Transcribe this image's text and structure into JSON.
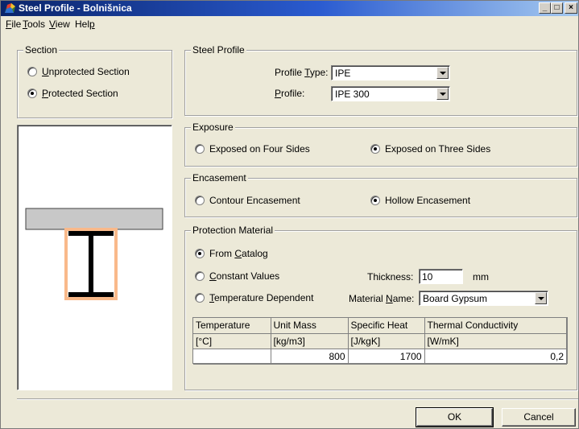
{
  "window": {
    "title": "Steel Profile - Bolnišnica",
    "controls": {
      "minimize": "_",
      "maximize": "□",
      "close": "×"
    }
  },
  "menu": [
    {
      "label": "File",
      "mnemonic": "F"
    },
    {
      "label": "Tools",
      "mnemonic": "T"
    },
    {
      "label": "View",
      "mnemonic": "V"
    },
    {
      "label": "Help",
      "mnemonic": "p"
    }
  ],
  "section": {
    "legend": "Section",
    "options": [
      {
        "label": "Unprotected Section",
        "checked": false
      },
      {
        "label": "Protected Section",
        "checked": true
      }
    ]
  },
  "steel_profile": {
    "legend": "Steel Profile",
    "profile_type_label": "Profile Type:",
    "profile_type_value": "IPE",
    "profile_label": "Profile:",
    "profile_value": "IPE 300"
  },
  "exposure": {
    "legend": "Exposure",
    "options": [
      {
        "label": "Exposed on Four Sides",
        "checked": false
      },
      {
        "label": "Exposed on Three Sides",
        "checked": true
      }
    ]
  },
  "encasement": {
    "legend": "Encasement",
    "options": [
      {
        "label": "Contour Encasement",
        "checked": false
      },
      {
        "label": "Hollow Encasement",
        "checked": true
      }
    ]
  },
  "protection": {
    "legend": "Protection Material",
    "options": [
      {
        "label": "From Catalog",
        "checked": true
      },
      {
        "label": "Constant Values",
        "checked": false
      },
      {
        "label": "Temperature Dependent",
        "checked": false
      }
    ],
    "thickness_label": "Thickness:",
    "thickness_value": "10",
    "thickness_unit": "mm",
    "material_label": "Material Name:",
    "material_value": "Board Gypsum",
    "table": {
      "headers": [
        "Temperature",
        "Unit Mass",
        "Specific Heat",
        "Thermal Conductivity"
      ],
      "units": [
        "[°C]",
        "[kg/m3]",
        "[J/kgK]",
        "[W/mK]"
      ],
      "rows": [
        [
          "",
          "800",
          "1700",
          "0,2"
        ]
      ]
    }
  },
  "buttons": {
    "ok": "OK",
    "cancel": "Cancel"
  },
  "colors": {
    "slab": "#c8c8c8",
    "steel": "#000000",
    "protection": "#f9b98a",
    "title_start": "#0a246a",
    "title_end": "#a6caf0"
  }
}
